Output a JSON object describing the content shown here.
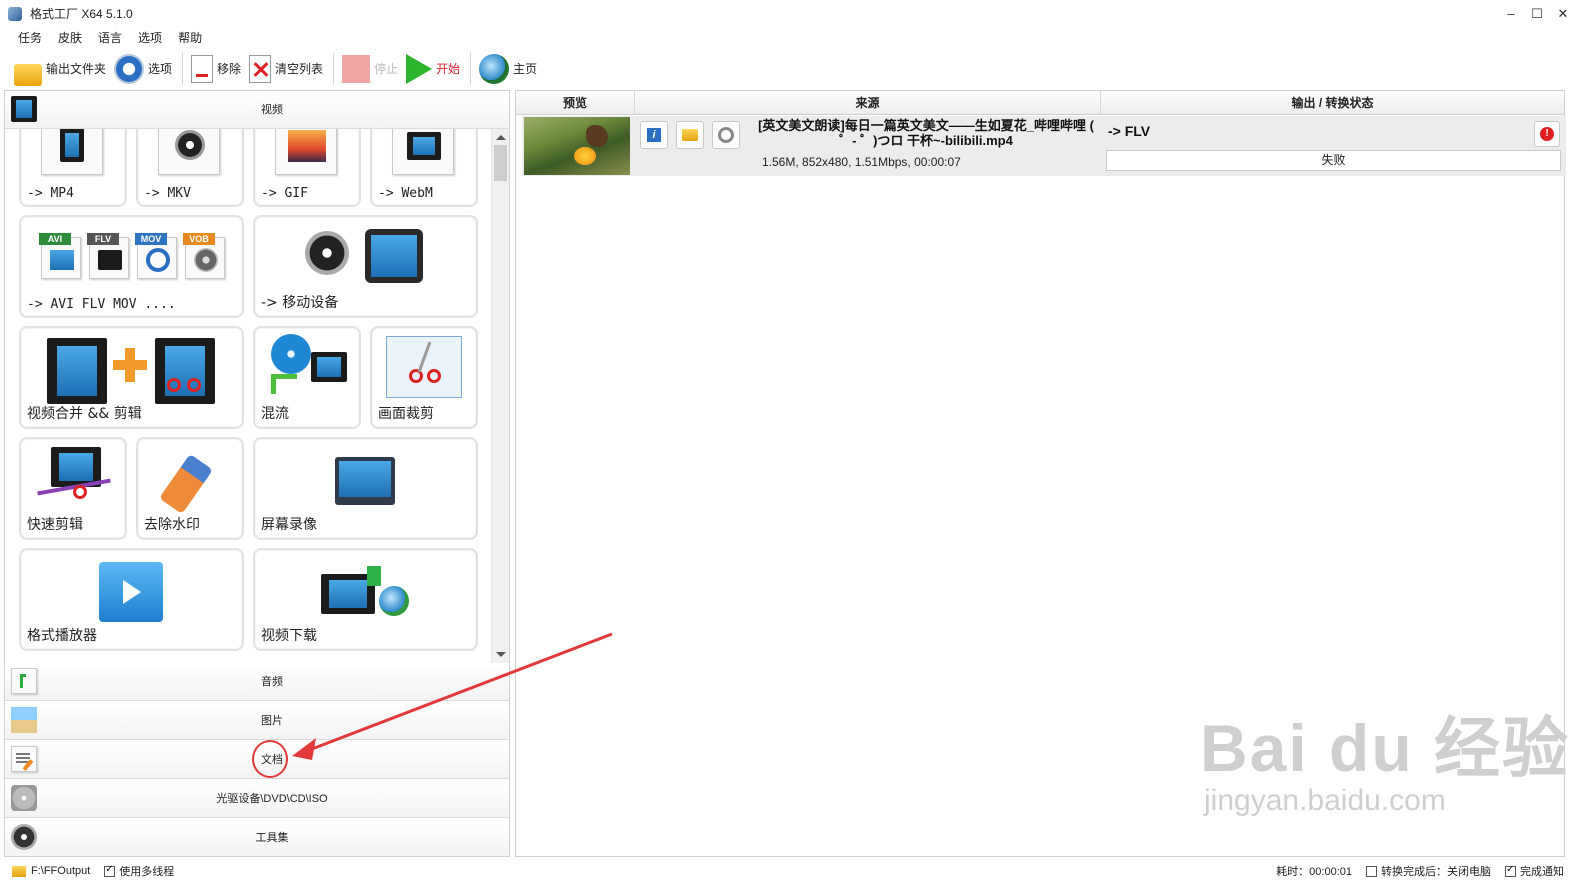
{
  "window": {
    "title": "格式工厂 X64 5.1.0",
    "controls": {
      "minimize": "–",
      "maximize": "☐",
      "close": "✕"
    }
  },
  "menu": [
    "任务",
    "皮肤",
    "语言",
    "选项",
    "帮助"
  ],
  "toolbar": {
    "output_folder": "输出文件夹",
    "options": "选项",
    "remove": "移除",
    "clear_list": "清空列表",
    "stop": "停止",
    "start": "开始",
    "home": "主页"
  },
  "left": {
    "video_header": "视频",
    "tiles": {
      "mp4": "-> MP4",
      "mkv": "-> MKV",
      "gif": "-> GIF",
      "webm": "-> WebM",
      "avi_flv_mov": "-> AVI FLV MOV ....",
      "mobile": "-> 移动设备",
      "merge": "视频合并 && 剪辑",
      "mux": "混流",
      "crop": "画面裁剪",
      "quick_clip": "快速剪辑",
      "watermark": "去除水印",
      "screen_record": "屏幕录像",
      "player": "格式播放器",
      "download": "视频下载"
    },
    "format_tags": {
      "avi": "AVI",
      "flv": "FLV",
      "mov": "MOV",
      "vob": "VOB"
    },
    "categories": {
      "audio": "音频",
      "image": "图片",
      "document": "文档",
      "rom": "光驱设备\\DVD\\CD\\ISO",
      "tools": "工具集"
    }
  },
  "right": {
    "columns": {
      "preview": "预览",
      "source": "来源",
      "output": "输出 / 转换状态"
    },
    "task": {
      "source_name": "[英文美文朗读]每日一篇英文美文——生如夏花_哔哩哔哩 ( ゜- ゜)つロ 干杯~-bilibili.mp4",
      "file_info": "1.56M, 852x480, 1.51Mbps, 00:00:07",
      "output_format": "-> FLV",
      "status": "失败",
      "info_glyph": "i",
      "error_glyph": "!"
    }
  },
  "statusbar": {
    "output_path": "F:\\FFOutput",
    "multithread": "使用多线程",
    "elapsed": "耗时：00:00:01",
    "after_convert": "转换完成后：关闭电脑",
    "notify": "完成通知"
  },
  "watermark": {
    "main": "Bai du 经验",
    "sub": "jingyan.baidu.com"
  },
  "colors": {
    "annotation": "#e23a3a",
    "start_green": "#2db52d",
    "accent_red": "#d22"
  }
}
